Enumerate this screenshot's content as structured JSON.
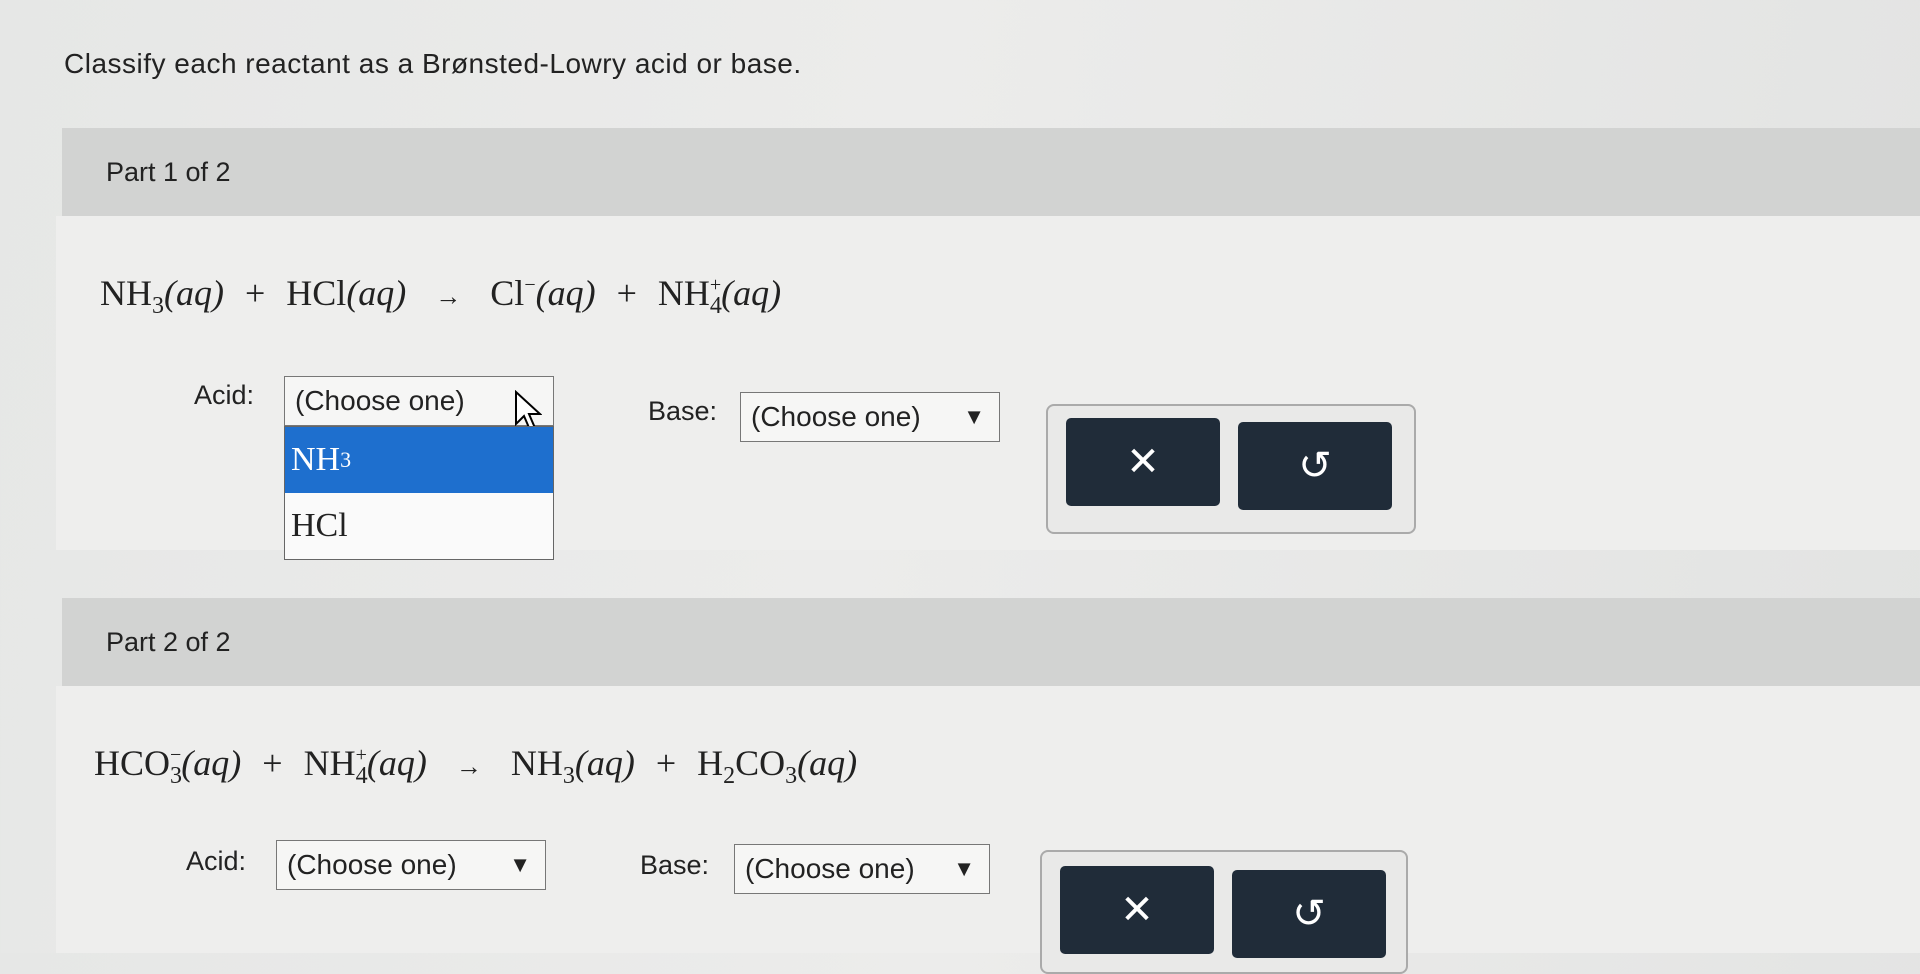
{
  "instruction": "Classify each reactant as a Brønsted-Lowry acid or base.",
  "parts": [
    {
      "title": "Part 1 of 2",
      "equation": {
        "r1": {
          "base": "NH",
          "sub": "3"
        },
        "r2": {
          "base": "HCl"
        },
        "p1": {
          "base": "Cl",
          "sup": "−"
        },
        "p2": {
          "base": "NH",
          "sub": "4",
          "sup": "+"
        },
        "state": "(aq)",
        "plus": "+",
        "arrow": "→"
      },
      "acid_label": "Acid:",
      "acid_value": "(Choose one)",
      "base_label": "Base:",
      "base_value": "(Choose one)",
      "dropdown_open": true,
      "dropdown_options": [
        {
          "base": "NH",
          "sub": "3",
          "selected": true
        },
        {
          "base": "HCl",
          "sub": "",
          "selected": false
        }
      ],
      "clear_icon": "✕",
      "undo_icon": "↺"
    },
    {
      "title": "Part 2 of 2",
      "equation": {
        "r1": {
          "base": "HCO",
          "sub": "3",
          "sup": "−"
        },
        "r2": {
          "base": "NH",
          "sub": "4",
          "sup": "+"
        },
        "p1": {
          "base": "NH",
          "sub": "3"
        },
        "p2": {
          "base": "H",
          "sub": "2",
          "base2": "CO",
          "sub2": "3"
        },
        "state": "(aq)",
        "plus": "+",
        "arrow": "→"
      },
      "acid_label": "Acid:",
      "acid_value": "(Choose one)",
      "base_label": "Base:",
      "base_value": "(Choose one)",
      "clear_icon": "✕",
      "undo_icon": "↺"
    }
  ],
  "caret": "▼",
  "colors": {
    "button": "#202c39",
    "highlight": "#1e6fce"
  }
}
